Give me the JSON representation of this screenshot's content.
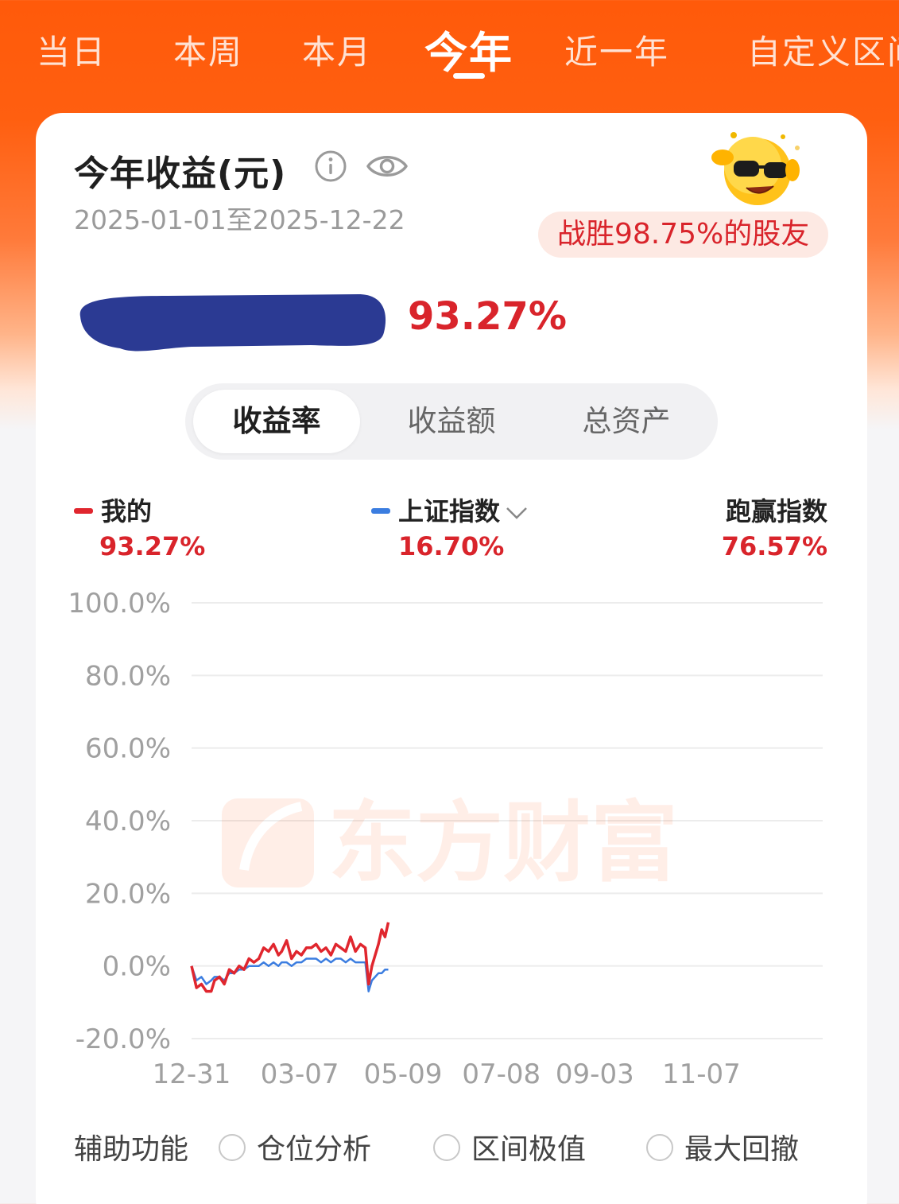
{
  "tabs": [
    {
      "label": "当日"
    },
    {
      "label": "本周"
    },
    {
      "label": "本月"
    },
    {
      "label": "今年",
      "active": true
    },
    {
      "label": "近一年"
    },
    {
      "label": "自定义区间"
    }
  ],
  "card": {
    "title": "今年收益(元)",
    "date_range": "2025-01-01至2025-12-22",
    "beat_text": "战胜98.75%的股友",
    "total_rate": "93.27%"
  },
  "segment": [
    "收益率",
    "收益额",
    "总资产"
  ],
  "legend": {
    "mine": {
      "label": "我的",
      "value": "93.27%",
      "color": "#e0262e"
    },
    "index": {
      "label": "上证指数",
      "value": "16.70%",
      "color": "#3b7de0"
    },
    "beat": {
      "label": "跑赢指数",
      "value": "76.57%"
    }
  },
  "watermark": "东方财富",
  "aux": {
    "label": "辅助功能",
    "options": [
      "仓位分析",
      "区间极值",
      "最大回撤"
    ]
  },
  "chart_data": {
    "type": "line",
    "y_ticks": [
      "100.0%",
      "80.0%",
      "60.0%",
      "40.0%",
      "20.0%",
      "0.0%",
      "-20.0%"
    ],
    "ylim": [
      -20,
      100
    ],
    "x_ticks": [
      "12-31",
      "03-07",
      "05-09",
      "07-08",
      "09-03",
      "11-07"
    ],
    "x_days": [
      0,
      66,
      129,
      189,
      246,
      311
    ],
    "xlim": [
      0,
      385
    ],
    "series": [
      {
        "name": "我的",
        "color": "#e0262e",
        "x": [
          0,
          3,
          6,
          9,
          12,
          14,
          17,
          20,
          23,
          26,
          29,
          32,
          35,
          38,
          41,
          44,
          47,
          50,
          53,
          55,
          58,
          61,
          64,
          67,
          70,
          73,
          76,
          79,
          82,
          85,
          88,
          91,
          94,
          97,
          100,
          103,
          106,
          108,
          110,
          112,
          114,
          116,
          118,
          120
        ],
        "values": [
          0,
          -6,
          -5,
          -7,
          -7,
          -4,
          -3,
          -5,
          -1,
          -2,
          0,
          -1,
          2,
          1,
          2,
          5,
          4,
          6,
          3,
          4,
          7,
          2,
          4,
          3,
          5,
          5,
          6,
          4,
          5,
          3,
          6,
          5,
          4,
          8,
          4,
          6,
          5,
          -5,
          0,
          3,
          6,
          10,
          8,
          12
        ]
      },
      {
        "name": "上证指数",
        "color": "#3b7de0",
        "x": [
          0,
          3,
          6,
          9,
          12,
          14,
          17,
          20,
          23,
          26,
          29,
          32,
          35,
          38,
          41,
          44,
          47,
          50,
          53,
          55,
          58,
          61,
          64,
          67,
          70,
          73,
          76,
          79,
          82,
          85,
          88,
          91,
          94,
          97,
          100,
          103,
          106,
          108,
          110,
          112,
          114,
          116,
          118,
          120
        ],
        "values": [
          0,
          -4,
          -3,
          -5,
          -4,
          -3,
          -3,
          -4,
          -2,
          -2,
          -1,
          -1,
          0,
          0,
          0,
          1,
          0,
          1,
          0,
          1,
          1,
          0,
          1,
          1,
          2,
          2,
          2,
          1,
          2,
          1,
          2,
          2,
          1,
          2,
          1,
          1,
          1,
          -7,
          -4,
          -3,
          -2,
          -2,
          -1,
          -1
        ]
      }
    ]
  }
}
